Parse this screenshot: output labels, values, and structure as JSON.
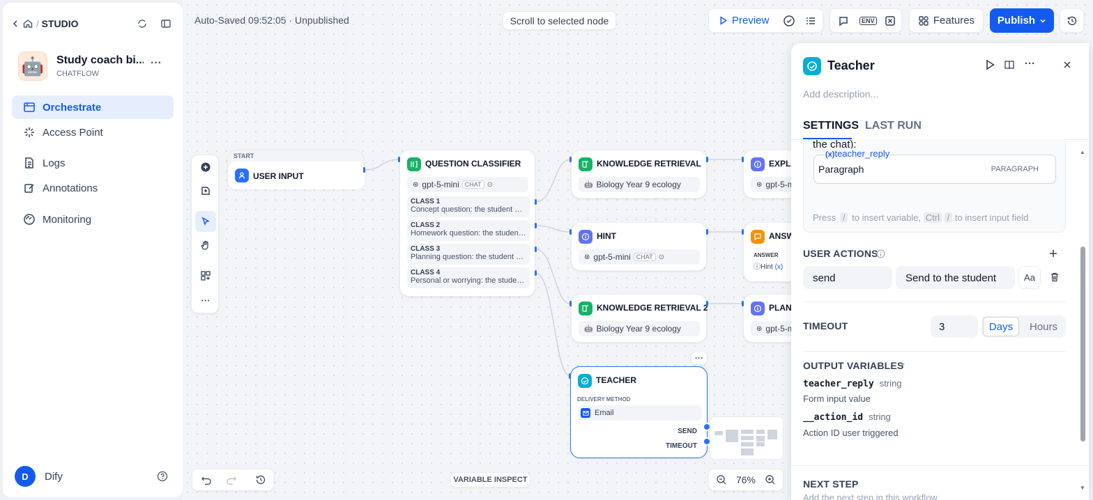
{
  "sidebar": {
    "breadcrumb": "STUDIO",
    "app_name": "Study coach bi...",
    "app_type": "CHATFLOW",
    "nav": [
      {
        "label": "Orchestrate"
      },
      {
        "label": "Access Point"
      },
      {
        "label": "Logs"
      },
      {
        "label": "Annotations"
      },
      {
        "label": "Monitoring"
      }
    ],
    "user": {
      "initial": "D",
      "name": "Dify"
    }
  },
  "header": {
    "status": "Auto-Saved 09:52:05 · Unpublished",
    "scroll_btn": "Scroll to selected node",
    "preview": "Preview",
    "features": "Features",
    "publish": "Publish"
  },
  "nodes": {
    "start": {
      "label": "START",
      "title": "USER INPUT"
    },
    "classifier": {
      "title": "QUESTION CLASSIFIER",
      "model": "gpt-5-mini",
      "model_tag": "CHAT",
      "classes": [
        {
          "name": "CLASS 1",
          "desc": "Concept question: the student wants to understand"
        },
        {
          "name": "CLASS 2",
          "desc": "Homework question: the student needs help"
        },
        {
          "name": "CLASS 3",
          "desc": "Planning question: the student asks about"
        },
        {
          "name": "CLASS 4",
          "desc": "Personal or worrying: the student shares"
        }
      ]
    },
    "kr1": {
      "title": "KNOWLEDGE RETRIEVAL",
      "dataset": "Biology Year 9 ecology"
    },
    "hint": {
      "title": "HINT",
      "model": "gpt-5-mini",
      "model_tag": "CHAT"
    },
    "kr2": {
      "title": "KNOWLEDGE RETRIEVAL 2",
      "dataset": "Biology Year 9 ecology"
    },
    "explain": {
      "title": "EXPLA",
      "model": "gpt-5-m"
    },
    "answer": {
      "title": "ANSW",
      "label": "ANSWER",
      "chip": "Hint"
    },
    "plan": {
      "title": "PLANN",
      "model": "gpt-5-m"
    },
    "teacher": {
      "title": "TEACHER",
      "delivery_label": "DELIVERY METHOD",
      "delivery": "Email",
      "out1": "SEND",
      "out2": "TIMEOUT"
    }
  },
  "bottom": {
    "variable_inspect": "VARIABLE INSPECT",
    "zoom": "76%"
  },
  "panel": {
    "title": "Teacher",
    "description_placeholder": "Add description...",
    "tabs": [
      "SETTINGS",
      "LAST RUN"
    ],
    "prompt_tail": "the chat):",
    "var_chip": "teacher_reply",
    "field_label": "Paragraph",
    "field_type": "PARAGRAPH",
    "hint": {
      "a": "Press",
      "k1": "/",
      "b": "to insert variable,",
      "k2": "Ctrl",
      "k3": "/",
      "c": "to insert input field"
    },
    "user_actions": "USER ACTIONS",
    "action_id": "send",
    "action_text": "Send to the student",
    "timeout": "TIMEOUT",
    "timeout_value": "3",
    "days": "Days",
    "hours": "Hours",
    "output_vars": "OUTPUT VARIABLES",
    "outputs": [
      {
        "name": "teacher_reply",
        "type": "string",
        "desc": "Form input value"
      },
      {
        "name": "__action_id",
        "type": "string",
        "desc": "Action ID user triggered"
      }
    ],
    "next_step": "NEXT STEP",
    "next_step_desc": "Add the next step in this workflow"
  },
  "colors": {
    "primary": "#155aef",
    "classifier": "#16b364",
    "retrieval": "#16b364",
    "llm": "#6172f3",
    "answer": "#f79009",
    "teacher": "#06aed4"
  }
}
